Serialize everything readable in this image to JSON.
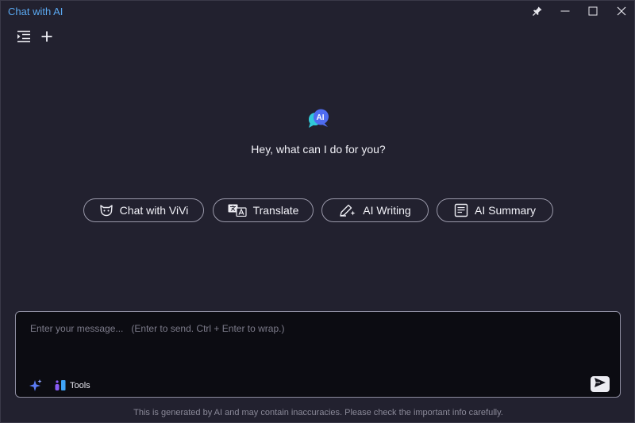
{
  "window": {
    "title": "Chat with AI"
  },
  "toolbar": {
    "sidebar_icon": "sidebar-toggle-icon",
    "new_chat_icon": "plus-icon"
  },
  "hero": {
    "logo_text": "AI",
    "greeting": "Hey, what can I do for you?"
  },
  "quick_actions": [
    {
      "label": "Chat with ViVi",
      "icon": "cat-icon"
    },
    {
      "label": "Translate",
      "icon": "translate-icon"
    },
    {
      "label": "AI Writing",
      "icon": "pen-sparkle-icon"
    },
    {
      "label": "AI Summary",
      "icon": "document-lines-icon"
    }
  ],
  "composer": {
    "placeholder": "Enter your message...   (Enter to send. Ctrl + Enter to wrap.)",
    "value": "",
    "tools_label": "Tools"
  },
  "disclaimer": "This is generated by AI and may contain inaccuracies. Please check the important info carefully.",
  "colors": {
    "background": "#22212f",
    "title_accent": "#5aa8f0",
    "composer_bg": "#0c0c12",
    "logo_blue": "#4f6cf0",
    "logo_cyan": "#31c9d8"
  }
}
